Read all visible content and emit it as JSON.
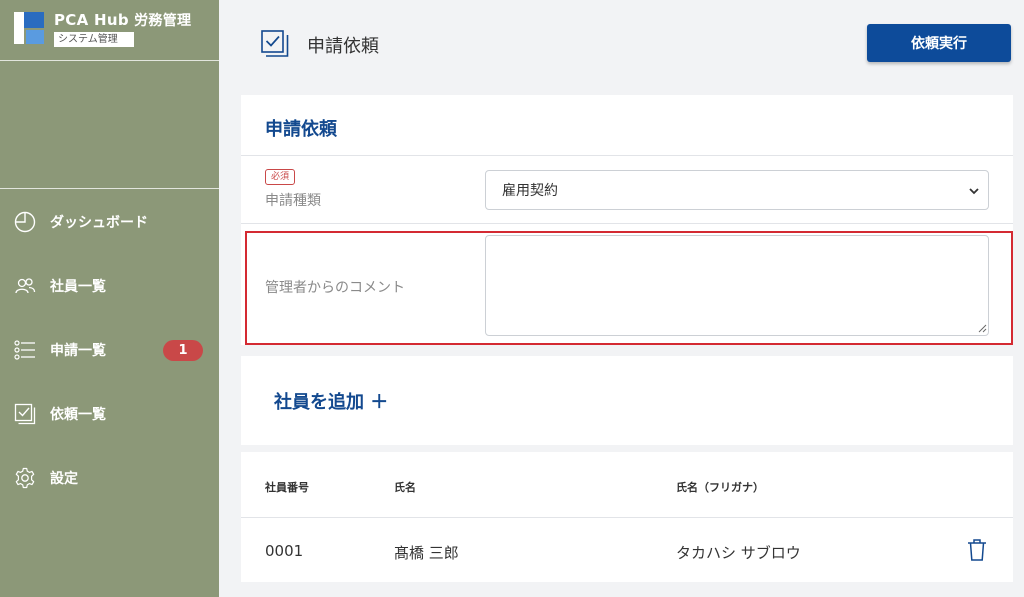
{
  "brand": {
    "name": "PCA Hub",
    "subtitle_top": "労務管理",
    "subtitle_badge": "システム管理"
  },
  "sidebar": {
    "items": [
      {
        "label": "ダッシュボード",
        "icon": "dashboard-icon"
      },
      {
        "label": "社員一覧",
        "icon": "users-icon"
      },
      {
        "label": "申請一覧",
        "icon": "list-icon",
        "badge": "1"
      },
      {
        "label": "依頼一覧",
        "icon": "checklist-icon"
      },
      {
        "label": "設定",
        "icon": "gear-icon"
      }
    ]
  },
  "header": {
    "title": "申請依頼",
    "exec_button": "依頼実行"
  },
  "form": {
    "section_title": "申請依頼",
    "required_tag": "必須",
    "type_label": "申請種類",
    "type_value": "雇用契約",
    "comment_label": "管理者からのコメント",
    "comment_value": ""
  },
  "add_employee": {
    "label": "社員を追加 ＋"
  },
  "table": {
    "columns": [
      "社員番号",
      "氏名",
      "氏名（フリガナ）"
    ],
    "rows": [
      {
        "id": "0001",
        "name": "髙橋 三郎",
        "kana": "タカハシ サブロウ"
      }
    ]
  },
  "colors": {
    "sidebar": "#8c9878",
    "accent": "#13498f",
    "button": "#0d4b9a",
    "badge": "#c94848",
    "highlight": "#d42a32"
  }
}
